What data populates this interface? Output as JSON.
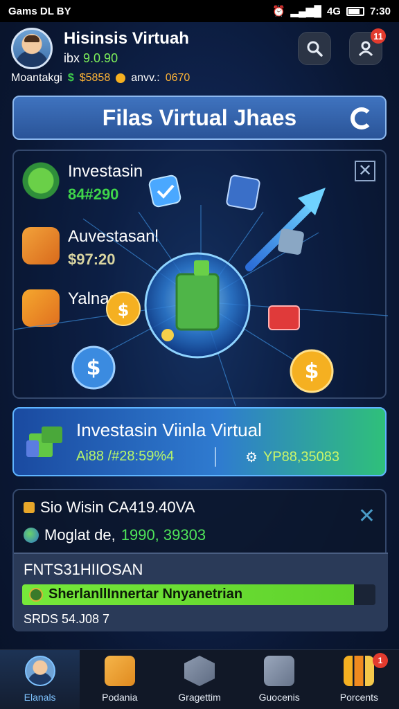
{
  "status_bar": {
    "left_text": "Gams DL BY",
    "time": "7:30",
    "signal_text": "4G"
  },
  "header": {
    "name": "Hisinsis Virtuah",
    "sub_prefix": "ibx",
    "sub_value": "9.0.90",
    "stats_label": "Moantakgi",
    "stats_cash": "$5858",
    "stats_coins_label": "anvv.:",
    "stats_coins": "0670",
    "profile_badge": "11"
  },
  "title_banner": {
    "title": "Filas Virtual Jhaes"
  },
  "list": [
    {
      "title": "Investasin",
      "value": "84#290"
    },
    {
      "title": "Auvestasanl",
      "value": "$97:20"
    },
    {
      "title": "Yalnas",
      "value": ""
    }
  ],
  "invest_card": {
    "title": "Investasin Viinla Virtual",
    "left_value": "Ai88 /#28:59%4",
    "right_value": "YP88,35083"
  },
  "info_panel": {
    "line1": "Sio Wisin CA419.40VA",
    "line2_label": "Moglat de,",
    "line2_value": "1990, 39303",
    "sub_title": "FNTS31HIIOSAN",
    "progress_label": "SherlanllInnertar Nnyanetrian",
    "progress_fraction": 0.94,
    "sub_bottom": "SRDS 54.J08 7"
  },
  "bottom_nav": [
    {
      "label": "Elanals",
      "active": true,
      "badge": ""
    },
    {
      "label": "Podania",
      "active": false,
      "badge": ""
    },
    {
      "label": "Gragettim",
      "active": false,
      "badge": ""
    },
    {
      "label": "Guocenis",
      "active": false,
      "badge": ""
    },
    {
      "label": "Porcents",
      "active": false,
      "badge": "1"
    }
  ],
  "colors": {
    "accent": "#3f73bf",
    "green": "#3fd64a",
    "gold": "#f5b021",
    "badge": "#e23b2e"
  },
  "icons": [
    "search-icon",
    "profile-icon",
    "refresh-icon",
    "close-icon",
    "globe-icon",
    "coin-icon",
    "chart-icon",
    "calendar-icon"
  ]
}
